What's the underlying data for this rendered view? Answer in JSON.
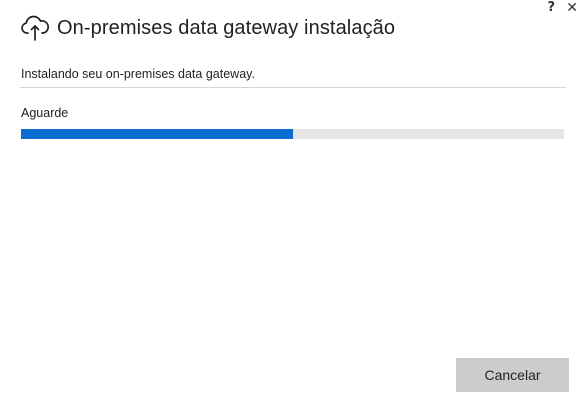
{
  "window": {
    "help_label": "?",
    "close_label": "✕"
  },
  "header": {
    "title": "On-premises data gateway instalação",
    "icon": "cloud-upload-icon"
  },
  "main": {
    "subtitle": "Instalando seu on-premises data gateway.",
    "status": "Aguarde",
    "progress": 0.5
  },
  "footer": {
    "cancel_label": "Cancelar"
  },
  "colors": {
    "progress_fill": "#0a6ed1",
    "progress_track": "#e6e6e6",
    "button_bg": "#cccccc"
  }
}
